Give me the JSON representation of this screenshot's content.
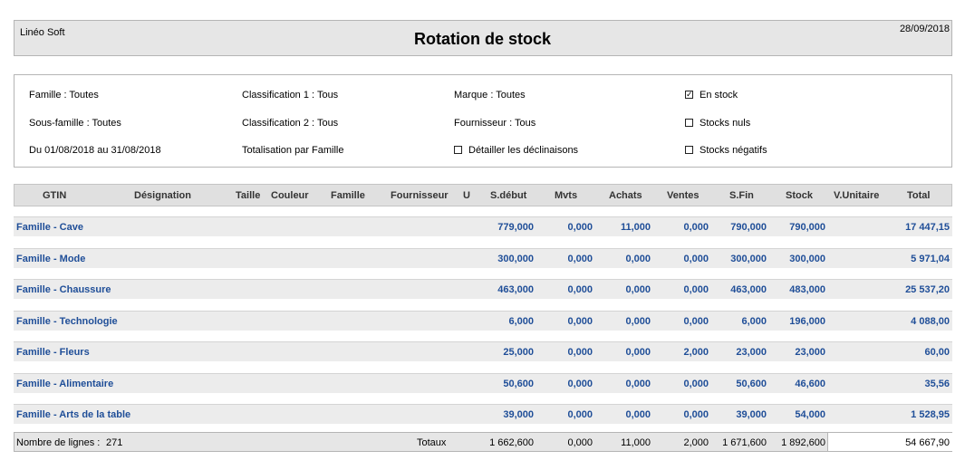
{
  "header": {
    "company": "Linéo Soft",
    "title": "Rotation de stock",
    "date": "28/09/2018"
  },
  "filters": {
    "famille": "Famille : Toutes",
    "sous_famille": "Sous-famille : Toutes",
    "periode": "Du 01/08/2018 au 31/08/2018",
    "classif1": "Classification 1 : Tous",
    "classif2": "Classification 2 : Tous",
    "totalisation": "Totalisation par Famille",
    "marque": "Marque : Toutes",
    "fournisseur": "Fournisseur : Tous",
    "detailler": {
      "label": "Détailler les déclinaisons",
      "checked": false
    },
    "en_stock": {
      "label": "En stock",
      "checked": true
    },
    "stocks_nuls": {
      "label": "Stocks nuls",
      "checked": false
    },
    "stocks_negatifs": {
      "label": "Stocks négatifs",
      "checked": false
    }
  },
  "columns": [
    "GTIN",
    "Désignation",
    "Taille",
    "Couleur",
    "Famille",
    "Fournisseur",
    "U",
    "S.début",
    "Mvts",
    "Achats",
    "Ventes",
    "S.Fin",
    "Stock",
    "V.Unitaire",
    "Total"
  ],
  "rows": [
    {
      "label": "Famille - Cave",
      "sdebut": "779,000",
      "mvts": "0,000",
      "achats": "11,000",
      "ventes": "0,000",
      "sfin": "790,000",
      "stock": "790,000",
      "total": "17 447,15"
    },
    {
      "label": "Famille - Mode",
      "sdebut": "300,000",
      "mvts": "0,000",
      "achats": "0,000",
      "ventes": "0,000",
      "sfin": "300,000",
      "stock": "300,000",
      "total": "5 971,04"
    },
    {
      "label": "Famille - Chaussure",
      "sdebut": "463,000",
      "mvts": "0,000",
      "achats": "0,000",
      "ventes": "0,000",
      "sfin": "463,000",
      "stock": "483,000",
      "total": "25 537,20"
    },
    {
      "label": "Famille - Technologie",
      "sdebut": "6,000",
      "mvts": "0,000",
      "achats": "0,000",
      "ventes": "0,000",
      "sfin": "6,000",
      "stock": "196,000",
      "total": "4 088,00"
    },
    {
      "label": "Famille - Fleurs",
      "sdebut": "25,000",
      "mvts": "0,000",
      "achats": "0,000",
      "ventes": "2,000",
      "sfin": "23,000",
      "stock": "23,000",
      "total": "60,00"
    },
    {
      "label": "Famille - Alimentaire",
      "sdebut": "50,600",
      "mvts": "0,000",
      "achats": "0,000",
      "ventes": "0,000",
      "sfin": "50,600",
      "stock": "46,600",
      "total": "35,56"
    },
    {
      "label": "Famille - Arts de la table",
      "sdebut": "39,000",
      "mvts": "0,000",
      "achats": "0,000",
      "ventes": "0,000",
      "sfin": "39,000",
      "stock": "54,000",
      "total": "1 528,95"
    }
  ],
  "footer": {
    "nb_lignes_label": "Nombre de lignes :",
    "nb_lignes": "271",
    "totaux_label": "Totaux",
    "sdebut": "1 662,600",
    "mvts": "0,000",
    "achats": "11,000",
    "ventes": "2,000",
    "sfin": "1 671,600",
    "stock": "1 892,600",
    "total": "54 667,90"
  },
  "colors": {
    "row_text": "#1f4e98",
    "header_bg": "#e6e6e6"
  }
}
